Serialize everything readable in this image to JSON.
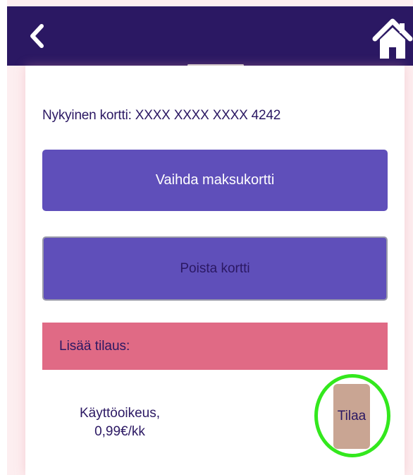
{
  "header": {
    "back_icon": "chevron-left-icon",
    "home_icon": "home-icon",
    "background_color": "#2b1863"
  },
  "payment": {
    "current_card_text": "Nykyinen kortti: XXXX XXXX XXXX 4242",
    "change_card_label": "Vaihda maksukortti",
    "delete_card_label": "Poista kortti",
    "button_color": "#5f4fba"
  },
  "subscriptions": {
    "section_title": "Lisää tilaus:",
    "section_color": "#e06a85",
    "items": [
      {
        "name": "Käyttöoikeus,",
        "price": "0,99€/kk",
        "order_label": "Tilaa",
        "order_button_color": "#c9a593",
        "highlight_color": "#33e81d"
      }
    ]
  }
}
